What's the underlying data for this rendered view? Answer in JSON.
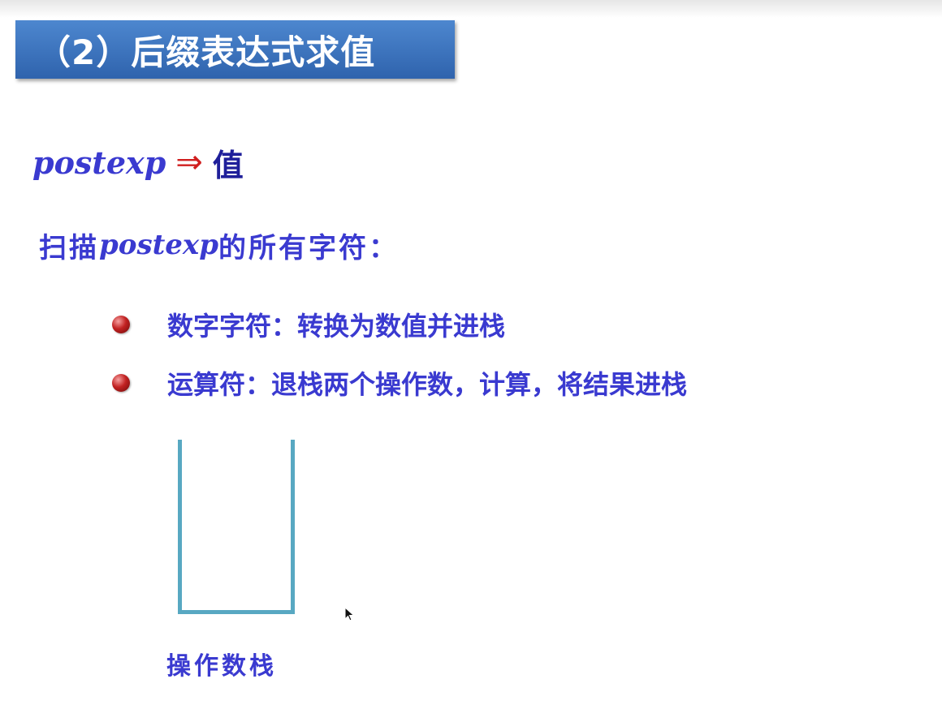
{
  "title": "（2）后缀表达式求值",
  "formula": {
    "left": "postexp",
    "arrow": "⇒",
    "right": "值"
  },
  "scan": {
    "prefix": "扫描",
    "keyword": "postexp",
    "suffix": "的所有字符："
  },
  "bullets": [
    {
      "text": "数字字符：转换为数值并进栈"
    },
    {
      "text": "运算符：退栈两个操作数，计算，将结果进栈"
    }
  ],
  "stack_label": "操作数栈",
  "colors": {
    "title_bar": "#3a73c0",
    "body_text": "#3a3ad0",
    "arrow": "#d01e1e",
    "stack_outline": "#58a8c2",
    "bullet": "#c22222"
  },
  "icons": {
    "bullet": "red-ball-bullet-icon",
    "cursor": "mouse-pointer-icon"
  }
}
